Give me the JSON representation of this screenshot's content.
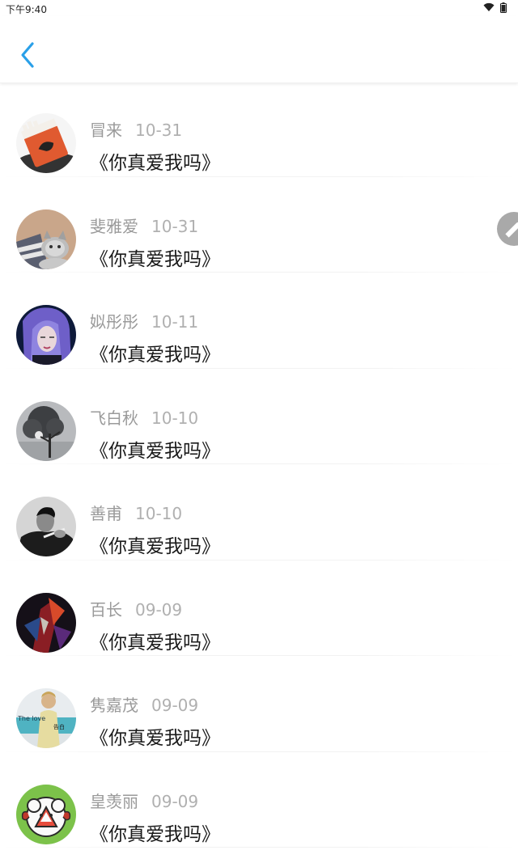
{
  "status": {
    "time": "下午9:40"
  },
  "items": [
    {
      "name": "冒来",
      "date": "10-31",
      "message": "《你真爱我吗》"
    },
    {
      "name": "斐雅爱",
      "date": "10-31",
      "message": "《你真爱我吗》"
    },
    {
      "name": "姒彤彤",
      "date": "10-11",
      "message": "《你真爱我吗》"
    },
    {
      "name": "飞白秋",
      "date": "10-10",
      "message": "《你真爱我吗》"
    },
    {
      "name": "善甫",
      "date": "10-10",
      "message": "《你真爱我吗》"
    },
    {
      "name": "百长",
      "date": "09-09",
      "message": "《你真爱我吗》"
    },
    {
      "name": "隽嘉茂",
      "date": "09-09",
      "message": "《你真爱我吗》",
      "avatar_text": [
        "The love",
        "告白"
      ]
    },
    {
      "name": "皇羡丽",
      "date": "09-09",
      "message": "《你真爱我吗》"
    }
  ],
  "icons": {
    "back": "chevron-left-icon",
    "fab": "pencil-icon",
    "wifi": "wifi-icon",
    "battery": "battery-icon"
  },
  "colors": {
    "accent": "#2aa0e8",
    "fab": "#a9a9a9"
  }
}
